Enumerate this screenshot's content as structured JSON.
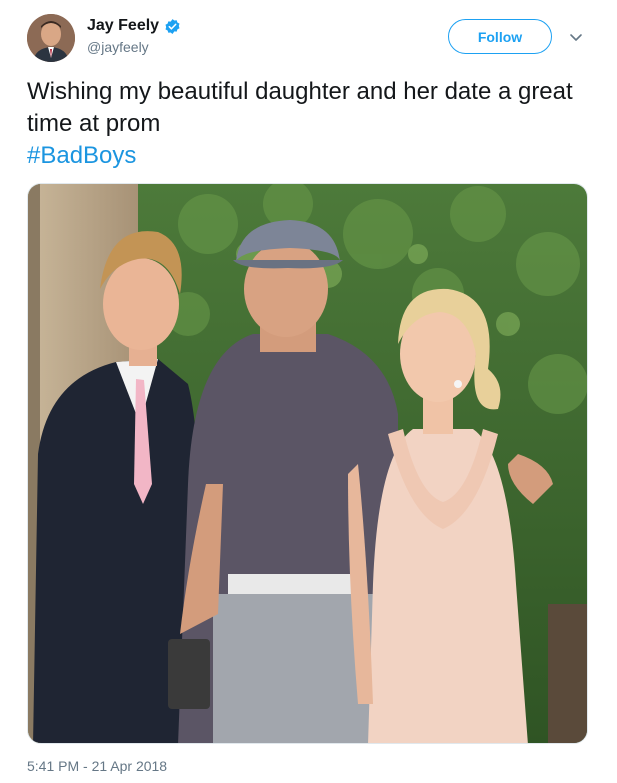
{
  "tweet": {
    "author_name": "Jay Feely",
    "author_handle": "@jayfeely",
    "verified": true,
    "follow_label": "Follow",
    "text": "Wishing my beautiful daughter and her date a great time at prom",
    "hashtag": "#BadBoys",
    "timestamp": "5:41 PM - 21 Apr 2018"
  },
  "colors": {
    "accent": "#1da1f2",
    "hashtag": "#1b95e0",
    "secondary_text": "#657786"
  },
  "icons": {
    "verified": "verified-badge-icon",
    "more": "chevron-down-icon"
  }
}
